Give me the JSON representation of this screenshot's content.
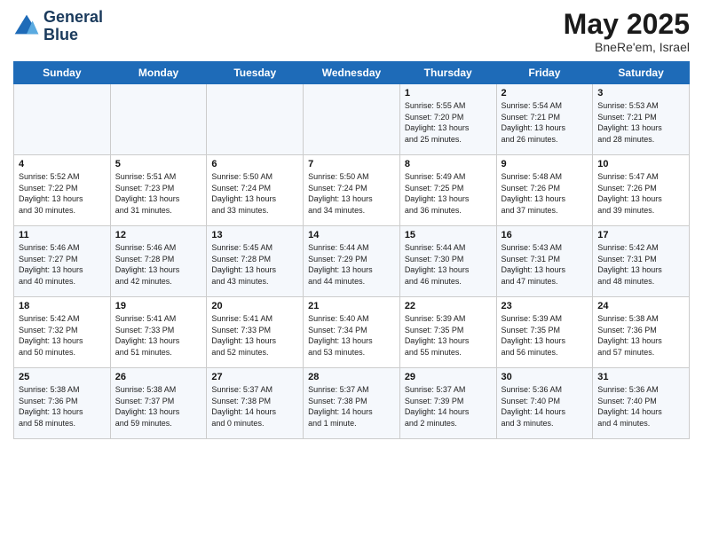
{
  "logo": {
    "line1": "General",
    "line2": "Blue"
  },
  "title": "May 2025",
  "subtitle": "BneRe'em, Israel",
  "weekdays": [
    "Sunday",
    "Monday",
    "Tuesday",
    "Wednesday",
    "Thursday",
    "Friday",
    "Saturday"
  ],
  "weeks": [
    [
      {
        "day": "",
        "info": ""
      },
      {
        "day": "",
        "info": ""
      },
      {
        "day": "",
        "info": ""
      },
      {
        "day": "",
        "info": ""
      },
      {
        "day": "1",
        "info": "Sunrise: 5:55 AM\nSunset: 7:20 PM\nDaylight: 13 hours\nand 25 minutes."
      },
      {
        "day": "2",
        "info": "Sunrise: 5:54 AM\nSunset: 7:21 PM\nDaylight: 13 hours\nand 26 minutes."
      },
      {
        "day": "3",
        "info": "Sunrise: 5:53 AM\nSunset: 7:21 PM\nDaylight: 13 hours\nand 28 minutes."
      }
    ],
    [
      {
        "day": "4",
        "info": "Sunrise: 5:52 AM\nSunset: 7:22 PM\nDaylight: 13 hours\nand 30 minutes."
      },
      {
        "day": "5",
        "info": "Sunrise: 5:51 AM\nSunset: 7:23 PM\nDaylight: 13 hours\nand 31 minutes."
      },
      {
        "day": "6",
        "info": "Sunrise: 5:50 AM\nSunset: 7:24 PM\nDaylight: 13 hours\nand 33 minutes."
      },
      {
        "day": "7",
        "info": "Sunrise: 5:50 AM\nSunset: 7:24 PM\nDaylight: 13 hours\nand 34 minutes."
      },
      {
        "day": "8",
        "info": "Sunrise: 5:49 AM\nSunset: 7:25 PM\nDaylight: 13 hours\nand 36 minutes."
      },
      {
        "day": "9",
        "info": "Sunrise: 5:48 AM\nSunset: 7:26 PM\nDaylight: 13 hours\nand 37 minutes."
      },
      {
        "day": "10",
        "info": "Sunrise: 5:47 AM\nSunset: 7:26 PM\nDaylight: 13 hours\nand 39 minutes."
      }
    ],
    [
      {
        "day": "11",
        "info": "Sunrise: 5:46 AM\nSunset: 7:27 PM\nDaylight: 13 hours\nand 40 minutes."
      },
      {
        "day": "12",
        "info": "Sunrise: 5:46 AM\nSunset: 7:28 PM\nDaylight: 13 hours\nand 42 minutes."
      },
      {
        "day": "13",
        "info": "Sunrise: 5:45 AM\nSunset: 7:28 PM\nDaylight: 13 hours\nand 43 minutes."
      },
      {
        "day": "14",
        "info": "Sunrise: 5:44 AM\nSunset: 7:29 PM\nDaylight: 13 hours\nand 44 minutes."
      },
      {
        "day": "15",
        "info": "Sunrise: 5:44 AM\nSunset: 7:30 PM\nDaylight: 13 hours\nand 46 minutes."
      },
      {
        "day": "16",
        "info": "Sunrise: 5:43 AM\nSunset: 7:31 PM\nDaylight: 13 hours\nand 47 minutes."
      },
      {
        "day": "17",
        "info": "Sunrise: 5:42 AM\nSunset: 7:31 PM\nDaylight: 13 hours\nand 48 minutes."
      }
    ],
    [
      {
        "day": "18",
        "info": "Sunrise: 5:42 AM\nSunset: 7:32 PM\nDaylight: 13 hours\nand 50 minutes."
      },
      {
        "day": "19",
        "info": "Sunrise: 5:41 AM\nSunset: 7:33 PM\nDaylight: 13 hours\nand 51 minutes."
      },
      {
        "day": "20",
        "info": "Sunrise: 5:41 AM\nSunset: 7:33 PM\nDaylight: 13 hours\nand 52 minutes."
      },
      {
        "day": "21",
        "info": "Sunrise: 5:40 AM\nSunset: 7:34 PM\nDaylight: 13 hours\nand 53 minutes."
      },
      {
        "day": "22",
        "info": "Sunrise: 5:39 AM\nSunset: 7:35 PM\nDaylight: 13 hours\nand 55 minutes."
      },
      {
        "day": "23",
        "info": "Sunrise: 5:39 AM\nSunset: 7:35 PM\nDaylight: 13 hours\nand 56 minutes."
      },
      {
        "day": "24",
        "info": "Sunrise: 5:38 AM\nSunset: 7:36 PM\nDaylight: 13 hours\nand 57 minutes."
      }
    ],
    [
      {
        "day": "25",
        "info": "Sunrise: 5:38 AM\nSunset: 7:36 PM\nDaylight: 13 hours\nand 58 minutes."
      },
      {
        "day": "26",
        "info": "Sunrise: 5:38 AM\nSunset: 7:37 PM\nDaylight: 13 hours\nand 59 minutes."
      },
      {
        "day": "27",
        "info": "Sunrise: 5:37 AM\nSunset: 7:38 PM\nDaylight: 14 hours\nand 0 minutes."
      },
      {
        "day": "28",
        "info": "Sunrise: 5:37 AM\nSunset: 7:38 PM\nDaylight: 14 hours\nand 1 minute."
      },
      {
        "day": "29",
        "info": "Sunrise: 5:37 AM\nSunset: 7:39 PM\nDaylight: 14 hours\nand 2 minutes."
      },
      {
        "day": "30",
        "info": "Sunrise: 5:36 AM\nSunset: 7:40 PM\nDaylight: 14 hours\nand 3 minutes."
      },
      {
        "day": "31",
        "info": "Sunrise: 5:36 AM\nSunset: 7:40 PM\nDaylight: 14 hours\nand 4 minutes."
      }
    ]
  ]
}
